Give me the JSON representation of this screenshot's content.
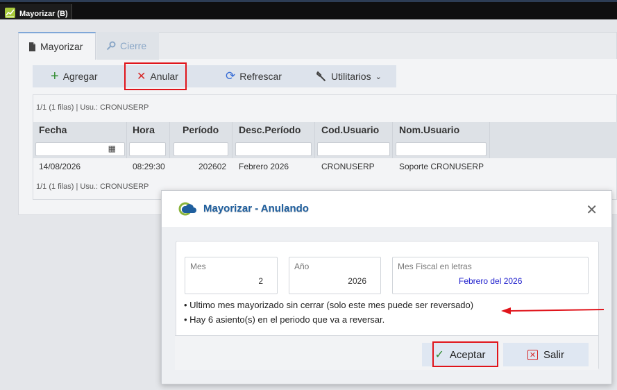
{
  "window": {
    "title": "Mayorizar (B)"
  },
  "tabs": [
    {
      "label": "Mayorizar"
    },
    {
      "label": "Cierre"
    }
  ],
  "toolbar": {
    "add_label": "Agregar",
    "anular_label": "Anular",
    "refresh_label": "Refrescar",
    "util_label": "Utilitarios"
  },
  "grid": {
    "info_top": "1/1 (1 filas) | Usu.: CRONUSERP",
    "info_bottom": "1/1 (1 filas) | Usu.: CRONUSERP",
    "columns": [
      "Fecha",
      "Hora",
      "Período",
      "Desc.Período",
      "Cod.Usuario",
      "Nom.Usuario"
    ],
    "rows": [
      {
        "fecha": "14/08/2026",
        "hora": "08:29:30",
        "periodo": "202602",
        "desc": "Febrero 2026",
        "cod": "CRONUSERP",
        "nom": "Soporte CRONUSERP"
      }
    ]
  },
  "dialog": {
    "title": "Mayorizar - Anulando",
    "mes_label": "Mes",
    "mes_value": "2",
    "anio_label": "Año",
    "anio_value": "2026",
    "mesfiscal_label": "Mes Fiscal en letras",
    "mesfiscal_value": "Febrero del 2026",
    "msg1": "• Ultimo mes mayorizado sin cerrar (solo este mes puede ser reversado)",
    "msg2": "• Hay 6 asiento(s) en el periodo que va a reversar.",
    "accept_label": "Aceptar",
    "exit_label": "Salir"
  },
  "colors": {
    "accent": "#1f5f9e",
    "highlight_red": "#e0141b",
    "brand_green": "#a7c93a"
  }
}
